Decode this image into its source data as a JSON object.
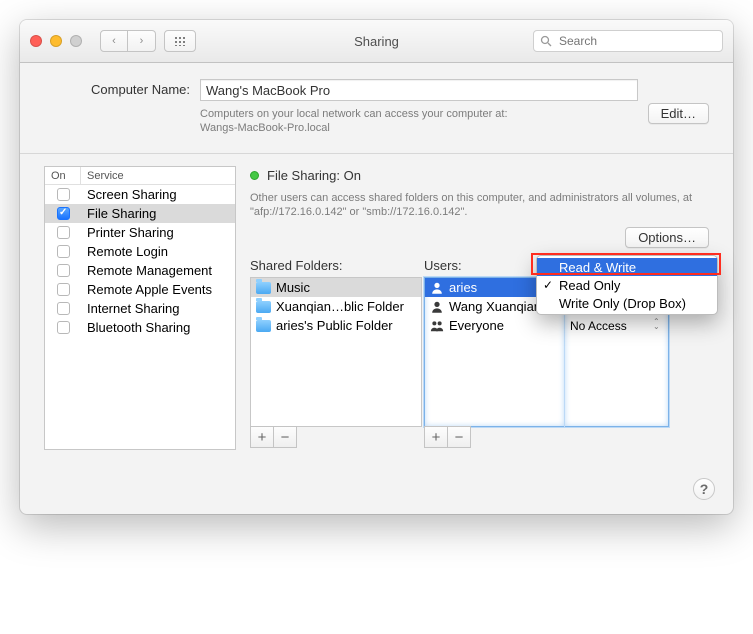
{
  "window": {
    "title": "Sharing",
    "search_placeholder": "Search"
  },
  "computer_name": {
    "label": "Computer Name:",
    "value": "Wang's MacBook Pro",
    "subtext1": "Computers on your local network can access your computer at:",
    "subtext2": "Wangs-MacBook-Pro.local",
    "edit_button": "Edit…"
  },
  "services": {
    "header_on": "On",
    "header_service": "Service",
    "items": [
      {
        "label": "Screen Sharing",
        "on": false,
        "selected": false
      },
      {
        "label": "File Sharing",
        "on": true,
        "selected": true
      },
      {
        "label": "Printer Sharing",
        "on": false,
        "selected": false
      },
      {
        "label": "Remote Login",
        "on": false,
        "selected": false
      },
      {
        "label": "Remote Management",
        "on": false,
        "selected": false
      },
      {
        "label": "Remote Apple Events",
        "on": false,
        "selected": false
      },
      {
        "label": "Internet Sharing",
        "on": false,
        "selected": false
      },
      {
        "label": "Bluetooth Sharing",
        "on": false,
        "selected": false
      }
    ]
  },
  "detail": {
    "status_title": "File Sharing: On",
    "description": "Other users can access shared folders on this computer, and administrators all volumes, at \"afp://172.16.0.142\" or \"smb://172.16.0.142\".",
    "options_button": "Options…"
  },
  "shared_folders": {
    "title": "Shared Folders:",
    "items": [
      {
        "label": "Music",
        "selected": true
      },
      {
        "label": "Xuanqian…blic Folder",
        "selected": false
      },
      {
        "label": "aries's Public Folder",
        "selected": false
      }
    ]
  },
  "users": {
    "title": "Users:",
    "items": [
      {
        "label": "aries",
        "icon": "single",
        "selected": true
      },
      {
        "label": "Wang Xuanqian",
        "icon": "single",
        "selected": false
      },
      {
        "label": "Everyone",
        "icon": "group",
        "selected": false
      }
    ]
  },
  "permissions": {
    "items": [
      {
        "label": ""
      },
      {
        "label": "Read Only"
      },
      {
        "label": "No Access",
        "dropdown": true
      }
    ]
  },
  "popup": {
    "items": [
      {
        "label": "Read & Write",
        "highlighted": true,
        "checked": false
      },
      {
        "label": "Read Only",
        "highlighted": false,
        "checked": true
      },
      {
        "label": "Write Only (Drop Box)",
        "highlighted": false,
        "checked": false
      }
    ]
  },
  "glyphs": {
    "back": "‹",
    "forward": "›",
    "plus": "+",
    "minus": "−",
    "help": "?"
  }
}
